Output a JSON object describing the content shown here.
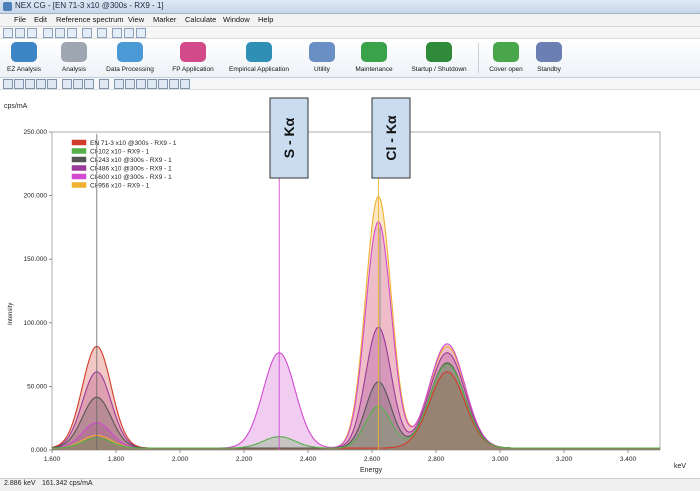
{
  "window": {
    "title": "NEX CG - [EN 71-3 x10 @300s - RX9 - 1]"
  },
  "menu": [
    "File",
    "Edit",
    "Reference spectrum",
    "View",
    "Marker",
    "Calculate",
    "Window",
    "Help"
  ],
  "ribbon": [
    {
      "label": "EZ Analysis",
      "icon": "ez-analysis-icon",
      "color": "#3d86c6"
    },
    {
      "label": "Analysis",
      "icon": "analysis-icon",
      "color": "#9ea7b1"
    },
    {
      "label": "Data Processing",
      "icon": "data-processing-icon",
      "color": "#4b9ad6"
    },
    {
      "label": "FP Application",
      "icon": "fp-application-icon",
      "color": "#d24a8a"
    },
    {
      "label": "Empirical Application",
      "icon": "empirical-application-icon",
      "color": "#2f8fb5"
    },
    {
      "label": "Utility",
      "icon": "utility-icon",
      "color": "#6a8fc4"
    },
    {
      "label": "Maintenance",
      "icon": "maintenance-icon",
      "color": "#3aa34a"
    },
    {
      "label": "Startup / Shutdown",
      "icon": "startup-shutdown-icon",
      "color": "#2f8a39"
    },
    {
      "label": "Cover open",
      "icon": "cover-open-icon",
      "color": "#49a64a"
    },
    {
      "label": "Standby",
      "icon": "standby-icon",
      "color": "#6b7fb3"
    }
  ],
  "status": {
    "energy": "2.886 keV",
    "intensity": "161.342 cps/mA"
  },
  "annotations": {
    "s": "S - Kα",
    "cl": "Cl - Kα"
  },
  "chart_data": {
    "type": "area",
    "ylabel": "Intensity",
    "xlabel": "Energy",
    "y_unit": "cps/mA",
    "x_unit": "keV",
    "xlim": [
      1.6,
      3.5
    ],
    "ylim": [
      0,
      250
    ],
    "x_ticks": [
      "1.600",
      "1.800",
      "2.000",
      "2.200",
      "2.400",
      "2.600",
      "2.800",
      "3.000",
      "3.200",
      "3.400"
    ],
    "y_ticks": [
      "0.000",
      "50.000",
      "100.000",
      "150.000",
      "200.000",
      "250.000"
    ],
    "legend_position": "top-left",
    "series": [
      {
        "name": "EN 71-3 x10 @300s - RX9 - 1",
        "color": "#d23a2a",
        "peaks": {
          "p1": 80,
          "s": 0,
          "cl": 0,
          "p3": 60
        }
      },
      {
        "name": "Cl-102 x10 - RX9 - 1",
        "color": "#55b04a",
        "peaks": {
          "p1": 8,
          "s": 9,
          "cl": 33,
          "p3": 66
        }
      },
      {
        "name": "Cl-243 x10 @300s - RX9 - 1",
        "color": "#555555",
        "peaks": {
          "p1": 40,
          "s": 0,
          "cl": 52,
          "p3": 67
        }
      },
      {
        "name": "Cl-486 x10 @300s - RX9 - 1",
        "color": "#9a3a9a",
        "peaks": {
          "p1": 60,
          "s": 0,
          "cl": 95,
          "p3": 75
        }
      },
      {
        "name": "Cl-600 x10 @300s - RX9 - 1",
        "color": "#d24ad0",
        "peaks": {
          "p1": 20,
          "s": 75,
          "cl": 178,
          "p3": 82
        }
      },
      {
        "name": "Cl-956 x10 - RX9 - 1",
        "color": "#f0b030",
        "peaks": {
          "p1": 10,
          "s": 0,
          "cl": 198,
          "p3": 80
        }
      }
    ],
    "peak_centers": {
      "p1": 1.74,
      "s": 2.31,
      "cl": 2.62,
      "p3": 2.835
    },
    "markers": [
      2.31,
      2.625,
      2.62
    ]
  }
}
